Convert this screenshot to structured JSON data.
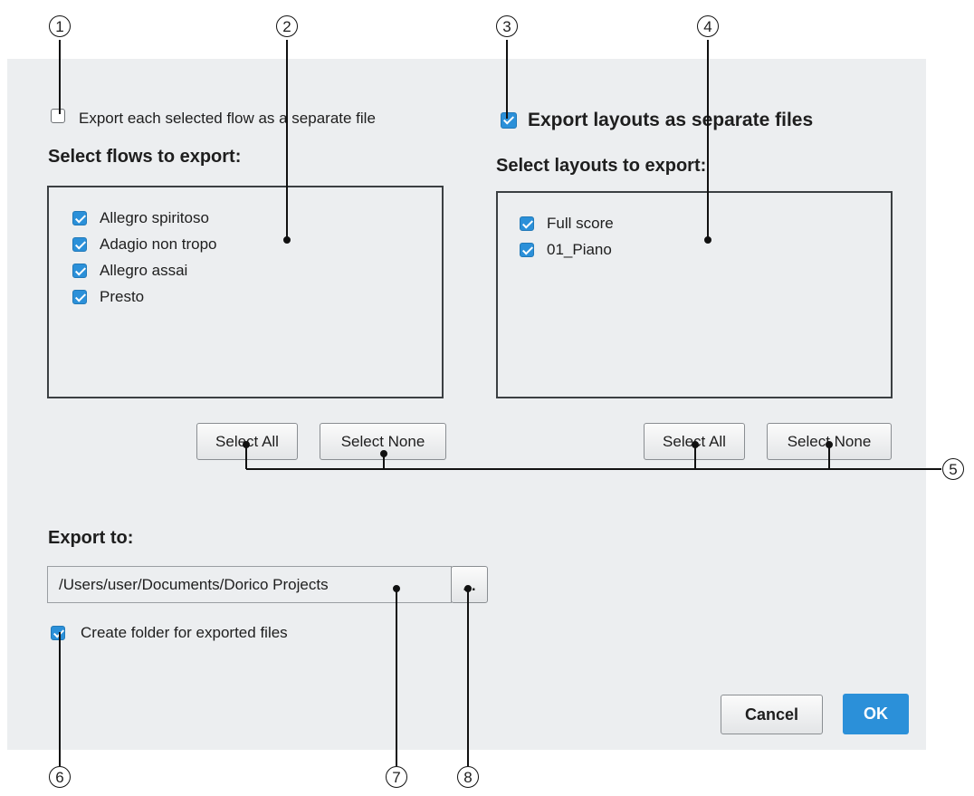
{
  "flows": {
    "separate_file_checked": false,
    "separate_file_label": "Export each selected flow as a separate file",
    "heading": "Select flows to export:",
    "items": [
      {
        "label": "Allegro spiritoso",
        "checked": true
      },
      {
        "label": "Adagio non tropo",
        "checked": true
      },
      {
        "label": "Allegro assai",
        "checked": true
      },
      {
        "label": "Presto",
        "checked": true
      }
    ],
    "select_all": "Select All",
    "select_none": "Select None"
  },
  "layouts": {
    "separate_files_checked": true,
    "separate_files_label": "Export layouts as separate files",
    "heading": "Select layouts to export:",
    "items": [
      {
        "label": "Full score",
        "checked": true
      },
      {
        "label": "01_Piano",
        "checked": true
      }
    ],
    "select_all": "Select All",
    "select_none": "Select None"
  },
  "export": {
    "heading": "Export to:",
    "path": "/Users/user/Documents/Dorico Projects",
    "browse_label": "...",
    "create_folder_checked": true,
    "create_folder_label": "Create folder for exported files"
  },
  "footer": {
    "cancel": "Cancel",
    "ok": "OK"
  },
  "colors": {
    "accent": "#2b90d9",
    "panel": "#eceef0"
  },
  "callouts": [
    "①",
    "②",
    "③",
    "④",
    "⑤",
    "⑥",
    "⑦",
    "⑧"
  ]
}
